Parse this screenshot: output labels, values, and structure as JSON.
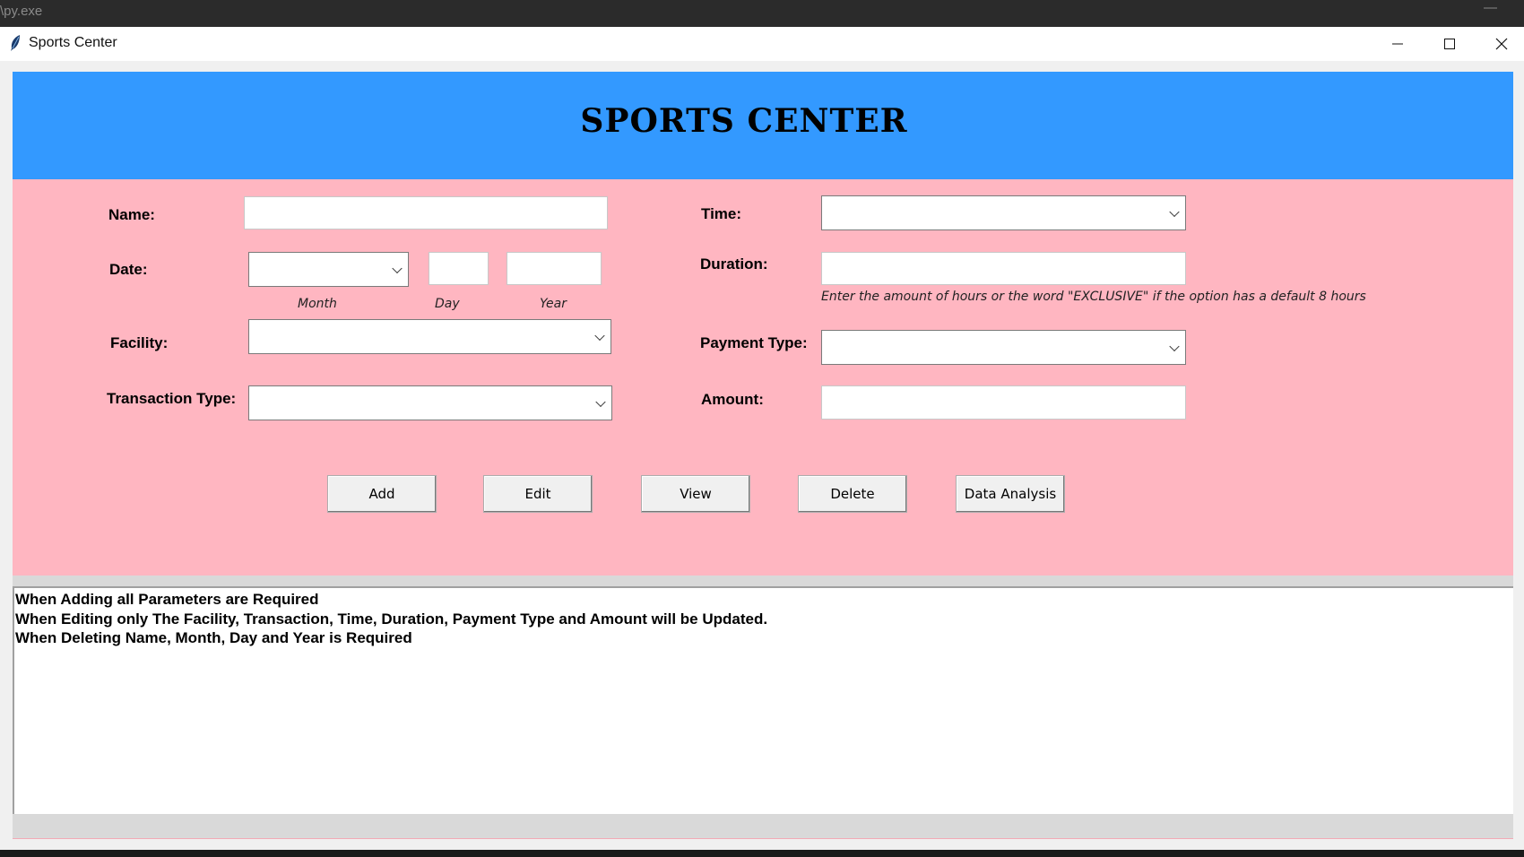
{
  "console": {
    "title": "\\py.exe",
    "minimize": "—"
  },
  "window": {
    "title": "Sports Center"
  },
  "app": {
    "heading": "SPORTS CENTER"
  },
  "colors": {
    "header": "#3399ff",
    "form_bg": "#ffb6c1",
    "output_bg": "#ffffff"
  },
  "form": {
    "name_label": "Name:",
    "name_value": "",
    "date_label": "Date:",
    "month_value": "",
    "day_value": "",
    "year_value": "",
    "month_sub": "Month",
    "day_sub": "Day",
    "year_sub": "Year",
    "facility_label": "Facility:",
    "facility_value": "",
    "transaction_label": "Transaction Type:",
    "transaction_value": "",
    "time_label": "Time:",
    "time_value": "",
    "duration_label": "Duration:",
    "duration_value": "",
    "duration_hint": "Enter the amount of hours or the word \"EXCLUSIVE\" if the option has a default 8 hours",
    "payment_label": "Payment Type:",
    "payment_value": "",
    "amount_label": "Amount:",
    "amount_value": ""
  },
  "buttons": {
    "add": "Add",
    "edit": "Edit",
    "view": "View",
    "delete": "Delete",
    "analysis": "Data Analysis"
  },
  "output": {
    "lines": [
      "When Adding all Parameters are Required",
      "When Editing only The Facility, Transaction, Time, Duration, Payment Type and Amount will be Updated.",
      "When Deleting Name, Month, Day and Year is Required"
    ]
  }
}
